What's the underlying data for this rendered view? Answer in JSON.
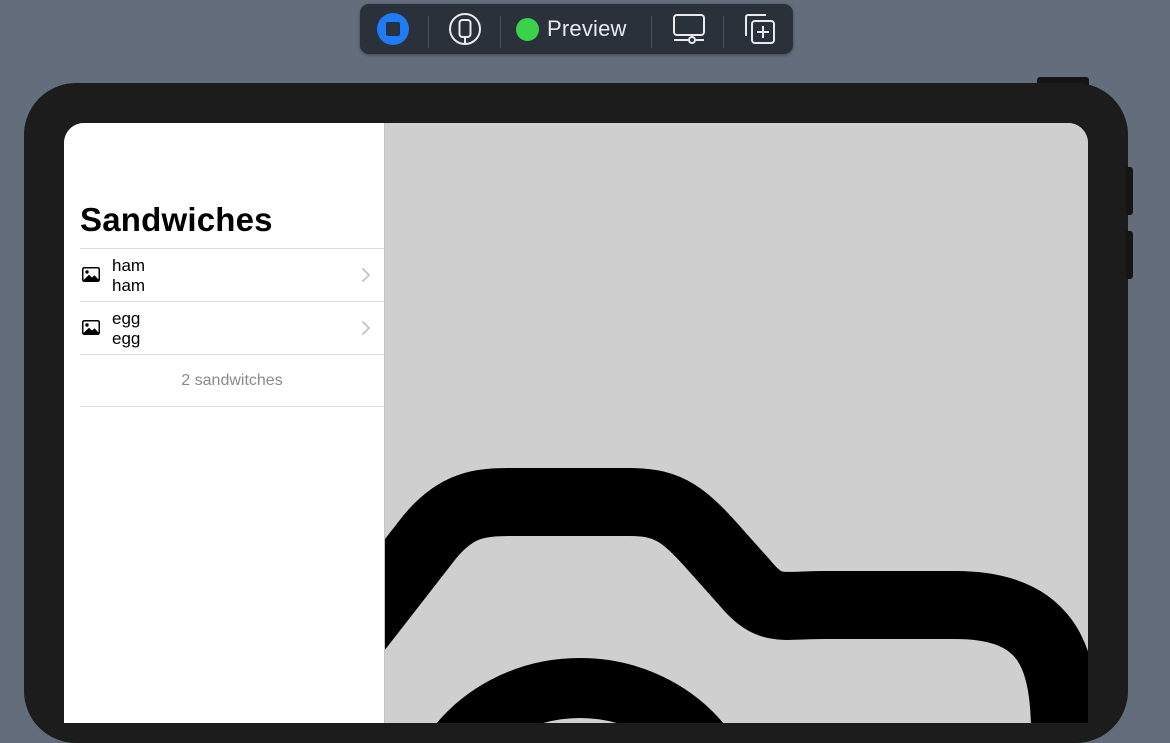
{
  "toolbar": {
    "live_icon": "stop-square-icon",
    "device_icon": "device-select-icon",
    "preview_label": "Preview",
    "preview_status_color": "#3bd24b",
    "display_icon": "display-settings-icon",
    "duplicate_icon": "duplicate-preview-icon",
    "accent": "#1f7cf5"
  },
  "sidebar": {
    "title": "Sandwiches",
    "items": [
      {
        "icon": "photo-icon",
        "title": "ham",
        "subtitle": "ham"
      },
      {
        "icon": "photo-icon",
        "title": "egg",
        "subtitle": "egg"
      }
    ],
    "footer": "2 sandwitches"
  },
  "detail": {
    "icon": "photo-placeholder-icon",
    "background": "#cfcfcf"
  }
}
